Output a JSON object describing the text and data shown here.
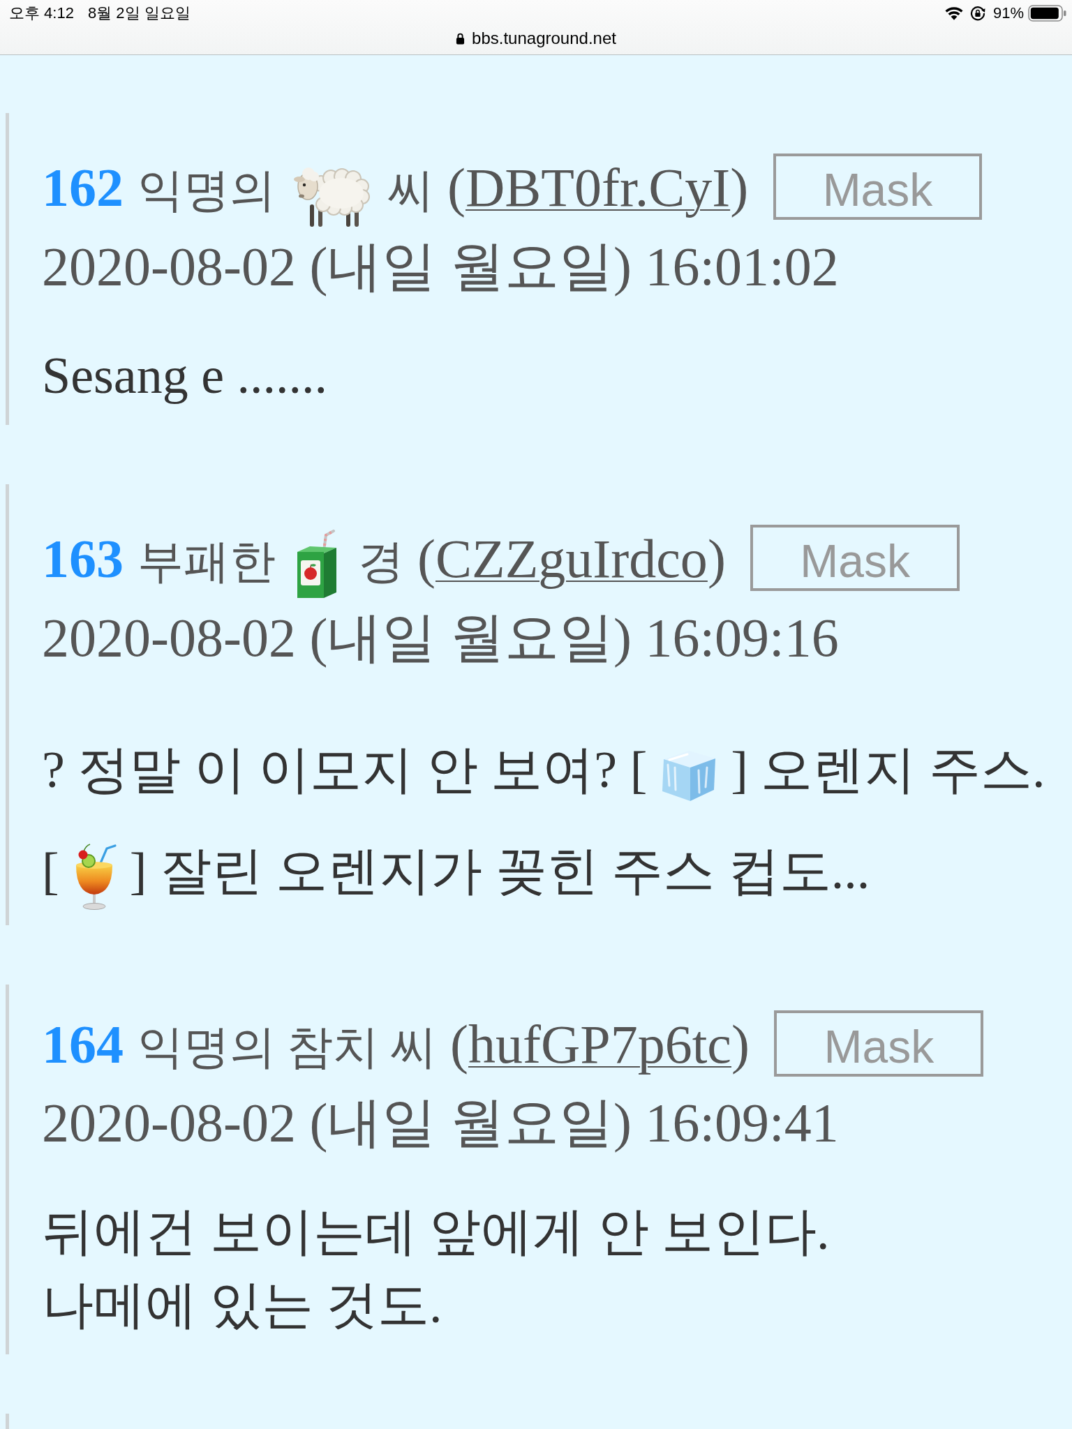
{
  "status_bar": {
    "time": "오후 4:12",
    "date": "8월 2일 일요일",
    "battery": "91%",
    "url": "bbs.tunaground.net"
  },
  "posts": [
    {
      "number": "162",
      "author": [
        {
          "kind": "text",
          "text": "익명의"
        },
        {
          "kind": "sheep"
        },
        {
          "kind": "text",
          "text": "씨"
        }
      ],
      "user": {
        "open": "(",
        "id": "DBT0fr.CyI",
        "close": ")"
      },
      "mask": "Mask",
      "date": "2020-08-02 (내일 월요일) 16:01:02",
      "body": [
        [
          {
            "kind": "text",
            "text": "Sesang e ......."
          }
        ]
      ]
    },
    {
      "number": "163",
      "author": [
        {
          "kind": "text",
          "text": "부패한"
        },
        {
          "kind": "juicebox"
        },
        {
          "kind": "text",
          "text": "경"
        }
      ],
      "user": {
        "open": "(",
        "id": "CZZguIrdco",
        "close": ")"
      },
      "mask": "Mask",
      "date": "2020-08-02 (내일 월요일) 16:09:16",
      "body": [
        [
          {
            "kind": "text",
            "text": "? 정말 이 이모지 안 보여? ["
          },
          {
            "kind": "ice"
          },
          {
            "kind": "text",
            "text": "] 오렌지 주스."
          }
        ],
        [
          {
            "kind": "text",
            "text": "["
          },
          {
            "kind": "cocktail"
          },
          {
            "kind": "text",
            "text": "] 잘린 오렌지가 꽂힌 주스 컵도..."
          }
        ]
      ]
    },
    {
      "number": "164",
      "author": [
        {
          "kind": "text",
          "text": "익명의 참치 씨"
        }
      ],
      "user": {
        "open": "(",
        "id": "hufGP7p6tc",
        "close": ")"
      },
      "mask": "Mask",
      "date": "2020-08-02 (내일 월요일) 16:09:41",
      "body": [
        [
          {
            "kind": "text",
            "text": "뒤에건 보이는데 앞에게 안 보인다."
          }
        ],
        [
          {
            "kind": "text",
            "text": "나메에 있는 것도."
          }
        ]
      ]
    }
  ]
}
